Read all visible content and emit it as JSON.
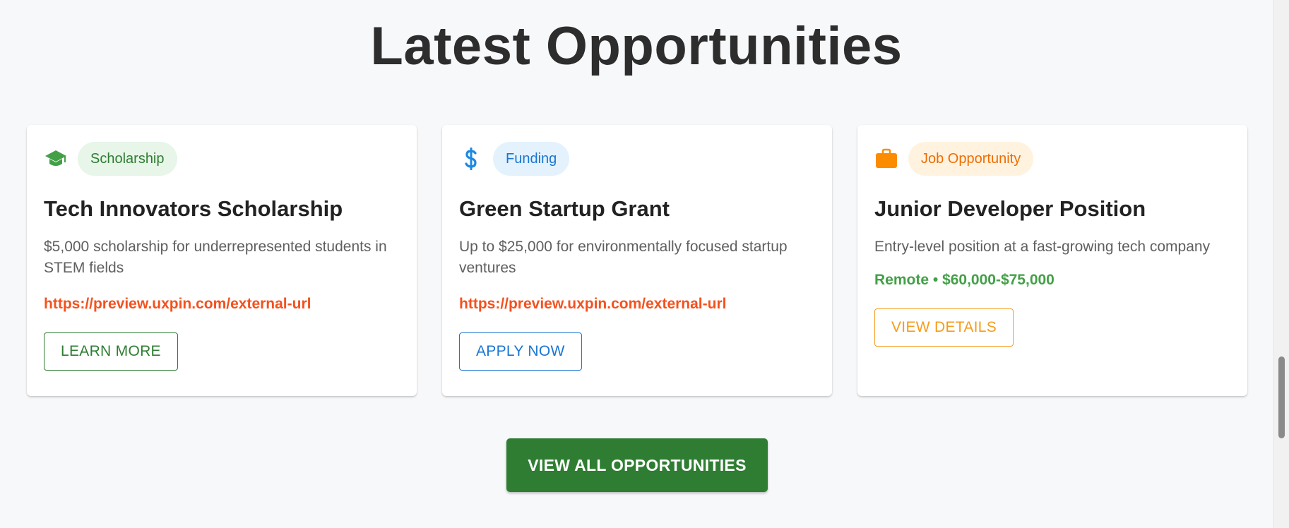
{
  "section": {
    "title": "Latest Opportunities"
  },
  "cards": [
    {
      "category": "Scholarship",
      "icon": "graduation-cap-icon",
      "accent": "#43a047",
      "chip_bg": "#e8f5e9",
      "chip_text": "#2e7d32",
      "title": "Tech Innovators Scholarship",
      "description": "$5,000 scholarship for underrepresented students in STEM fields",
      "link": "https://preview.uxpin.com/external-url",
      "button_label": "LEARN MORE",
      "button_color": "#2e7d32"
    },
    {
      "category": "Funding",
      "icon": "dollar-sign-icon",
      "accent": "#1e88e5",
      "chip_bg": "#e3f2fd",
      "chip_text": "#1976d2",
      "title": "Green Startup Grant",
      "description": "Up to $25,000 for environmentally focused startup ventures",
      "link": "https://preview.uxpin.com/external-url",
      "button_label": "APPLY NOW",
      "button_color": "#1976d2"
    },
    {
      "category": "Job Opportunity",
      "icon": "briefcase-icon",
      "accent": "#fb8c00",
      "chip_bg": "#fff3e0",
      "chip_text": "#ef6c00",
      "title": "Junior Developer Position",
      "description": "Entry-level position at a fast-growing tech company",
      "meta": "Remote • $60,000-$75,000",
      "button_label": "VIEW DETAILS",
      "button_color": "#f59c1a"
    }
  ],
  "view_all": {
    "label": "VIEW ALL OPPORTUNITIES",
    "bg": "#2e7d32"
  },
  "colors": {
    "link": "#f4511e",
    "meta": "#43a047",
    "background": "#f7f8fa"
  }
}
